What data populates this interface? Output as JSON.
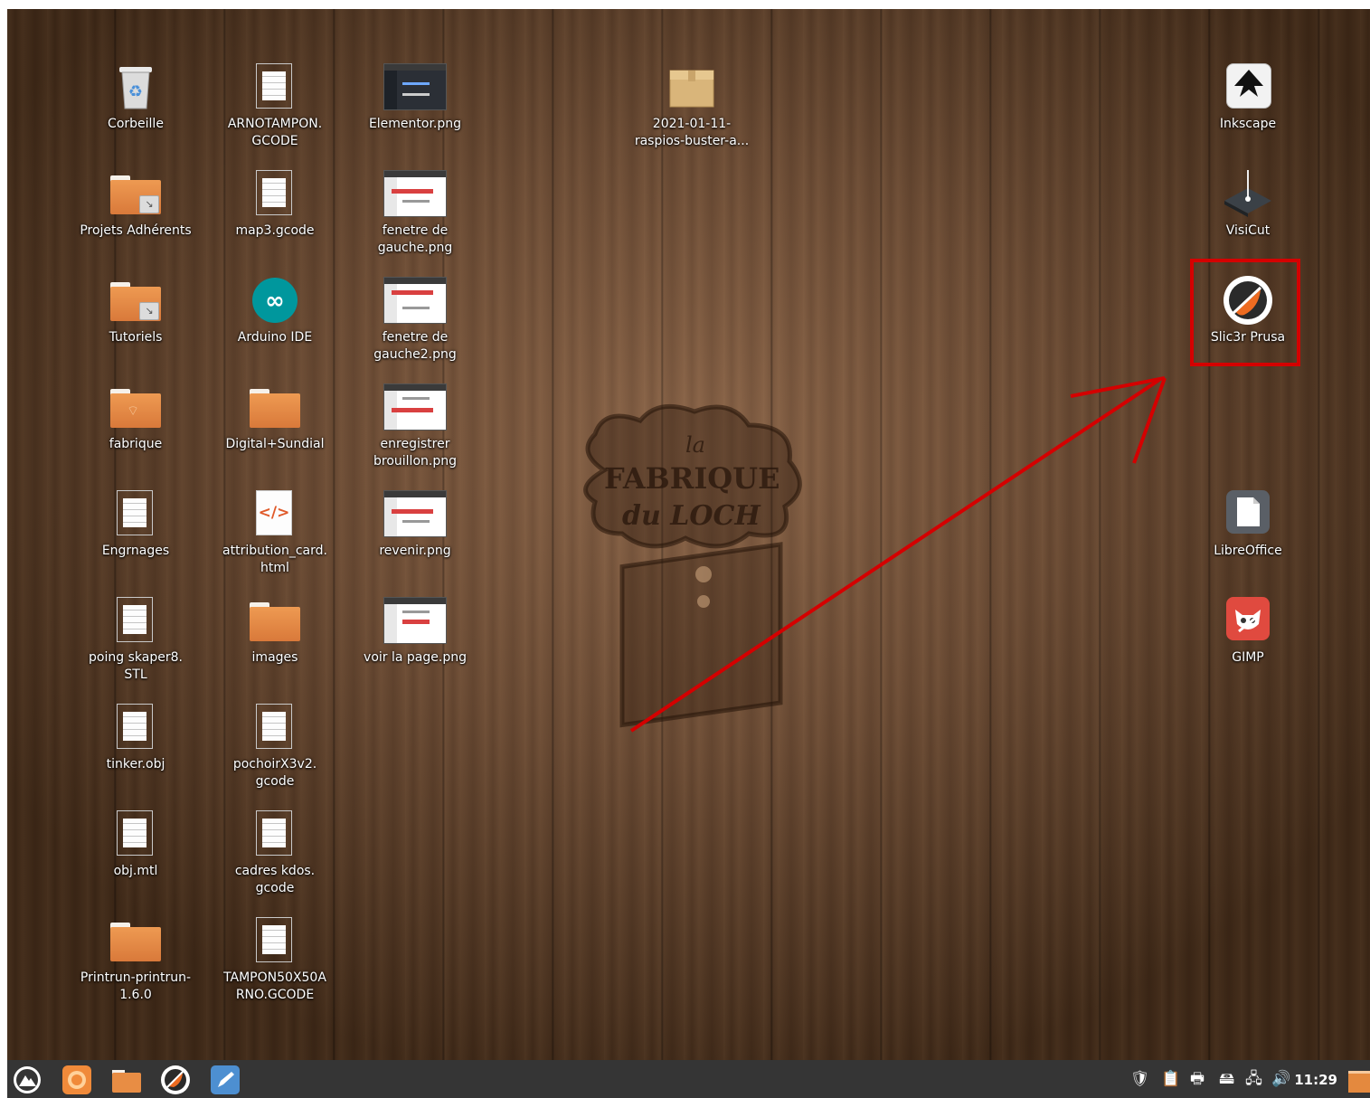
{
  "desktop": {
    "wallpaper_logo": {
      "line1": "la",
      "line2": "FABRIQUE",
      "line3": "du LOCH"
    },
    "icons": [
      {
        "id": "corbeille",
        "label": "Corbeille",
        "kind": "trash"
      },
      {
        "id": "projets",
        "label": "Projets Adhérents",
        "kind": "folder-link"
      },
      {
        "id": "tutoriels",
        "label": "Tutoriels",
        "kind": "folder-link"
      },
      {
        "id": "fabrique",
        "label": "fabrique",
        "kind": "folder-network"
      },
      {
        "id": "engrnages",
        "label": "Engrnages",
        "kind": "document"
      },
      {
        "id": "poing",
        "label": "poing skaper8.\nSTL",
        "kind": "document"
      },
      {
        "id": "tinker",
        "label": "tinker.obj",
        "kind": "document"
      },
      {
        "id": "objmtl",
        "label": "obj.mtl",
        "kind": "document"
      },
      {
        "id": "printrun",
        "label": "Printrun-printrun-\n1.6.0",
        "kind": "folder"
      },
      {
        "id": "arnotampon",
        "label": "ARNOTAMPON.\nGCODE",
        "kind": "document"
      },
      {
        "id": "map3",
        "label": "map3.gcode",
        "kind": "document"
      },
      {
        "id": "arduino",
        "label": "Arduino IDE",
        "kind": "app-arduino"
      },
      {
        "id": "digital",
        "label": "Digital+Sundial",
        "kind": "folder"
      },
      {
        "id": "attribution",
        "label": "attribution_card.\nhtml",
        "kind": "html"
      },
      {
        "id": "images",
        "label": "images",
        "kind": "folder"
      },
      {
        "id": "pochoir",
        "label": "pochoirX3v2.\ngcode",
        "kind": "document"
      },
      {
        "id": "cadres",
        "label": "cadres kdos.\ngcode",
        "kind": "document"
      },
      {
        "id": "tampon50",
        "label": "TAMPON50X50A\nRNO.GCODE",
        "kind": "document"
      },
      {
        "id": "elementor",
        "label": "Elementor.png",
        "kind": "screenshot-dark"
      },
      {
        "id": "fenetre1",
        "label": "fenetre de\ngauche.png",
        "kind": "screenshot"
      },
      {
        "id": "fenetre2",
        "label": "fenetre de\ngauche2.png",
        "kind": "screenshot"
      },
      {
        "id": "enregistrer",
        "label": "enregistrer\nbrouillon.png",
        "kind": "screenshot"
      },
      {
        "id": "revenir",
        "label": "revenir.png",
        "kind": "screenshot"
      },
      {
        "id": "voirpage",
        "label": "voir la page.png",
        "kind": "screenshot"
      },
      {
        "id": "raspios",
        "label": "2021-01-11-\nraspios-buster-a...",
        "kind": "package"
      },
      {
        "id": "inkscape",
        "label": "Inkscape",
        "kind": "app-inkscape"
      },
      {
        "id": "visicut",
        "label": "VisiCut",
        "kind": "app-visicut"
      },
      {
        "id": "slic3r",
        "label": "Slic3r Prusa",
        "kind": "app-slic3r"
      },
      {
        "id": "libreoffice",
        "label": "LibreOffice",
        "kind": "app-libreoffice"
      },
      {
        "id": "gimp",
        "label": "GIMP",
        "kind": "app-gimp"
      }
    ]
  },
  "annotation": {
    "highlight_target": "Slic3r Prusa",
    "color": "#d40000"
  },
  "taskbar": {
    "launchers": [
      "menu-logo-icon",
      "firefox-icon",
      "file-manager-icon",
      "slic3r-icon",
      "text-editor-icon"
    ],
    "tray": [
      "shield-icon",
      "clipboard-icon",
      "printer-icon",
      "disk-icon",
      "network-icon",
      "volume-icon"
    ],
    "clock": "11:29"
  }
}
